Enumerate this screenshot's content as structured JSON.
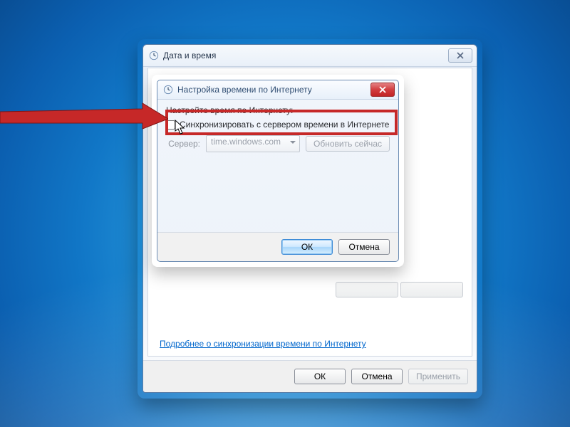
{
  "parent": {
    "title": "Дата и время",
    "placeholder_btn1": " ",
    "placeholder_btn2": " ",
    "link": "Подробнее о синхронизации времени по Интернету",
    "ok": "ОК",
    "cancel": "Отмена",
    "apply": "Применить"
  },
  "dialog": {
    "title": "Настройка времени по Интернету",
    "instruction": "Настройте время по Интернету:",
    "checkbox_label": "Синхронизировать с сервером времени в Интернете",
    "server_label": "Сервер:",
    "server_value": "time.windows.com",
    "update_now": "Обновить сейчас",
    "ok": "ОК",
    "cancel": "Отмена"
  }
}
